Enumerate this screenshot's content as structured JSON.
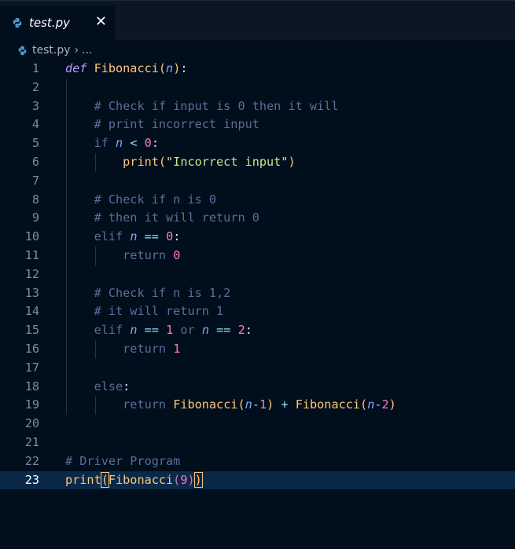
{
  "tab": {
    "title": "test.py",
    "close_glyph": "✕",
    "icon": "python-icon"
  },
  "breadcrumb": {
    "file": "test.py",
    "chevron": "›",
    "ellipsis": "..."
  },
  "editor": {
    "current_line": 23,
    "line_numbers": [
      "1",
      "2",
      "3",
      "4",
      "5",
      "6",
      "7",
      "8",
      "9",
      "10",
      "11",
      "12",
      "13",
      "14",
      "15",
      "16",
      "17",
      "18",
      "19",
      "20",
      "21",
      "22",
      "23"
    ],
    "lines": [
      "def Fibonacci(n):",
      "",
      "    # Check if input is 0 then it will",
      "    # print incorrect input",
      "    if n < 0:",
      "        print(\"Incorrect input\")",
      "",
      "    # Check if n is 0",
      "    # then it will return 0",
      "    elif n == 0:",
      "        return 0",
      "",
      "    # Check if n is 1,2",
      "    # it will return 1",
      "    elif n == 1 or n == 2:",
      "        return 1",
      "",
      "    else:",
      "        return Fibonacci(n-1) + Fibonacci(n-2)",
      "",
      "",
      "# Driver Program",
      "print(Fibonacci(9))"
    ]
  },
  "colors": {
    "background": "#010e1c",
    "keyword": "#c099ff",
    "function": "#ffc777",
    "parameter": "#82aaff",
    "comment": "#5a6e9a",
    "string": "#c3e88d",
    "number": "#ff79c6",
    "current_line": "#0a2847"
  }
}
